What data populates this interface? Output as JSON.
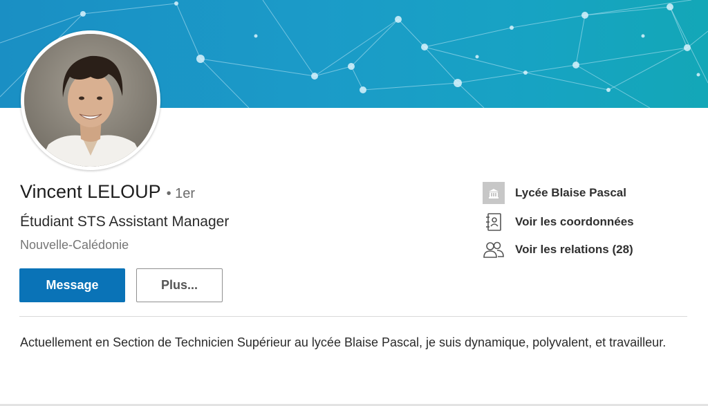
{
  "colors": {
    "banner_left": "#1a8fc4",
    "banner_right": "#13a7b7",
    "primary_button": "#0a73b7",
    "text_main": "#1d1d1d",
    "text_muted": "#767676"
  },
  "profile": {
    "name": "Vincent LELOUP",
    "degree": "• 1er",
    "headline": "Étudiant STS Assistant Manager",
    "location": "Nouvelle-Calédonie"
  },
  "actions": {
    "message_label": "Message",
    "more_label": "Plus..."
  },
  "side": {
    "school": {
      "label": "Lycée Blaise Pascal",
      "icon": "school-logo-icon"
    },
    "contact": {
      "label": "Voir les coordonnées",
      "icon": "contact-card-icon"
    },
    "connections": {
      "label": "Voir les relations (28)",
      "icon": "people-icon"
    }
  },
  "about": {
    "text": "Actuellement en Section de Technicien Supérieur au lycée Blaise Pascal, je suis dynamique, polyvalent, et travailleur."
  }
}
